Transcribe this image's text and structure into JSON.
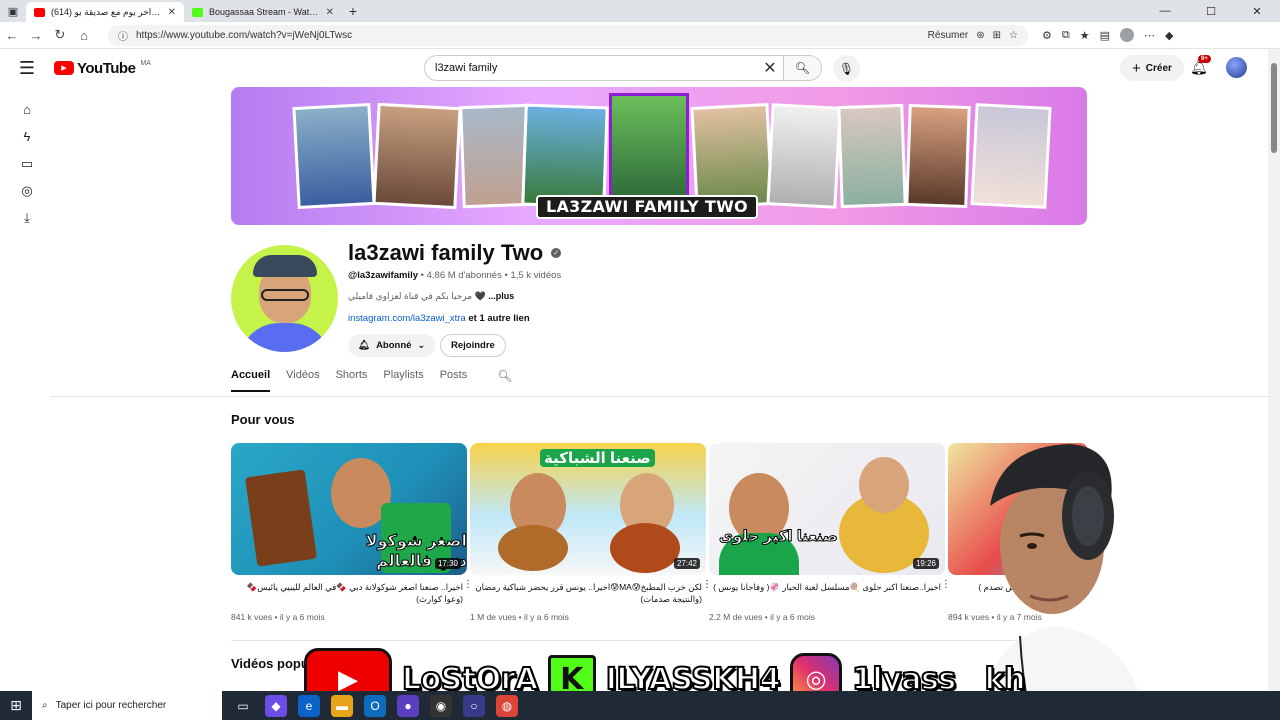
{
  "browser": {
    "tabs": [
      {
        "title": "(614) روتين...اخر يوم مع صديقة يو",
        "active": true,
        "favicon_color": "#ff0000"
      },
      {
        "title": "Bougassaa Stream - Watch Live on",
        "active": false,
        "favicon_color": "#53fc18"
      }
    ],
    "url": "https://www.youtube.com/watch?v=jWeNj0LTwsc",
    "summarize_label": "Résumer"
  },
  "youtube": {
    "logo_text": "YouTube",
    "country_code": "MA",
    "search_value": "l3zawi family",
    "create_label": "Créer",
    "notif_badge": "9+"
  },
  "channel": {
    "banner_title": "LA3ZAWI FAMILY TWO",
    "name": "la3zawi family Two",
    "handle": "@la3zawifamily",
    "subscribers": "4,86 M d'abonnés",
    "video_count": "1,5 k vidéos",
    "description": "مرحبا بكم في قناة لعزاوي فاميلي 🖤",
    "more_label": "...plus",
    "link": "instagram.com/la3zawi_xtra",
    "link_more": "et 1 autre lien",
    "subscribed_label": "Abonné",
    "join_label": "Rejoindre"
  },
  "tabs": [
    "Accueil",
    "Vidéos",
    "Shorts",
    "Playlists",
    "Posts"
  ],
  "sections": {
    "for_you": "Pour vous",
    "popular": "Vidéos popu"
  },
  "videos": [
    {
      "title": "اخيرا.. صنعنا اصغر شوكولاتة دبي 🍫في العالم لليبيي يائيس🍫(وعوا كوارث)",
      "views": "841 k vues",
      "age": "il y a 6 mois",
      "duration": "17:30",
      "thumb_text": "اصغر شوكولا دبي فالعالم"
    },
    {
      "title": "لكن خرب المطبخ😰MA😰اخيرا.. يونس قرر يحضر شباكية رمضان (والنتيجة صدمات)",
      "views": "1 M de vues",
      "age": "il y a 6 mois",
      "duration": "27:42",
      "thumb_text": "صنعنا الشباكية"
    },
    {
      "title": "اخيرا..صنعنا اكبر حلوى 🍭مسلسل لعبة الحبار 🦑( وفاجانا يونس )",
      "views": "2,2 M de vues",
      "age": "il y a 6 mois",
      "duration": "19:26",
      "thumb_text": "صنعنا اكبر حلوى"
    },
    {
      "title": "1.500 دولار 💵 (يونس تصدم )",
      "views": "894 k vues",
      "age": "il y a 7 mois",
      "duration": "",
      "thumb_text": ""
    }
  ],
  "overlay": {
    "name1": "LoStOrA",
    "name2": "ILYASSKH4",
    "name3": "1lyass__kh"
  },
  "taskbar": {
    "search_placeholder": "Taper ici pour rechercher"
  }
}
